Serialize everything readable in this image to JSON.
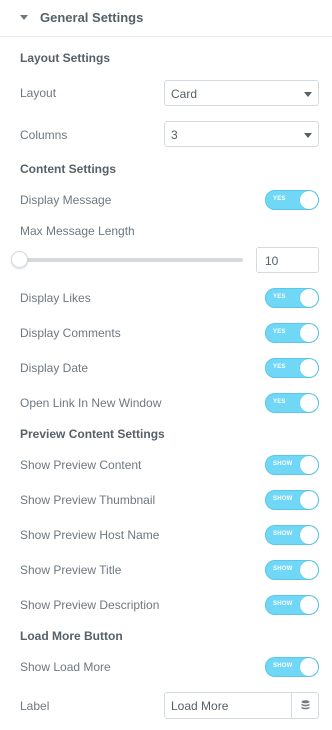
{
  "panel": {
    "title": "General Settings",
    "layout_heading": "Layout Settings",
    "layout": {
      "label": "Layout",
      "value": "Card"
    },
    "columns": {
      "label": "Columns",
      "value": "3"
    },
    "content_heading": "Content Settings",
    "display_message": {
      "label": "Display Message",
      "state": "YES"
    },
    "max_message_length": {
      "label": "Max Message Length",
      "value": "10",
      "slider_fraction": 0.0
    },
    "display_likes": {
      "label": "Display Likes",
      "state": "YES"
    },
    "display_comments": {
      "label": "Display Comments",
      "state": "YES"
    },
    "display_date": {
      "label": "Display Date",
      "state": "YES"
    },
    "open_link": {
      "label": "Open Link In New Window",
      "state": "YES"
    },
    "preview_heading": "Preview Content Settings",
    "show_preview_content": {
      "label": "Show Preview Content",
      "state": "SHOW"
    },
    "show_preview_thumbnail": {
      "label": "Show Preview Thumbnail",
      "state": "SHOW"
    },
    "show_preview_host": {
      "label": "Show Preview Host Name",
      "state": "SHOW"
    },
    "show_preview_title": {
      "label": "Show Preview Title",
      "state": "SHOW"
    },
    "show_preview_description": {
      "label": "Show Preview Description",
      "state": "SHOW"
    },
    "load_more_heading": "Load More Button",
    "show_load_more": {
      "label": "Show Load More",
      "state": "SHOW"
    },
    "label_field": {
      "label": "Label",
      "value": "Load More"
    }
  },
  "colors": {
    "switch_on": "#71d7f7",
    "border": "#d5dadf",
    "text": "#6d7882"
  }
}
